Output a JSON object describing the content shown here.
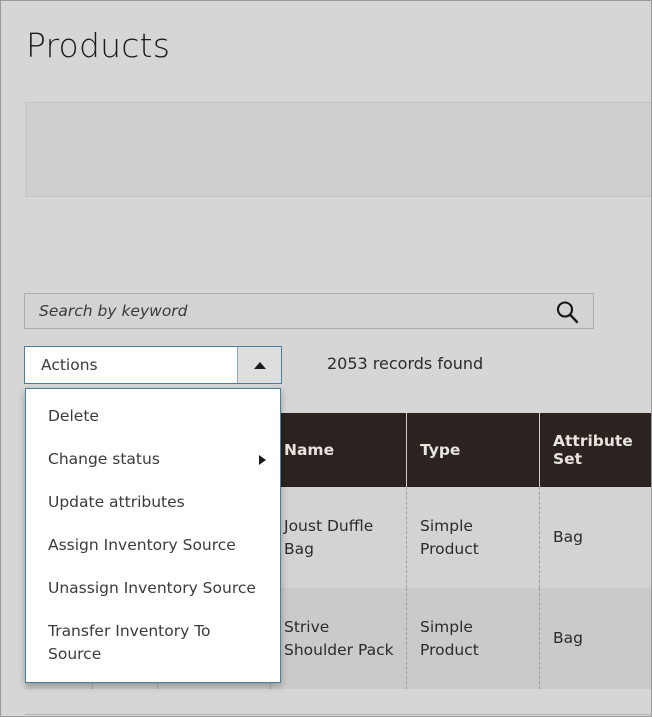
{
  "page": {
    "title": "Products",
    "background_color": "#d6d6d6"
  },
  "search": {
    "placeholder": "Search by keyword",
    "value": "",
    "icon": "search-icon"
  },
  "actions": {
    "label": "Actions",
    "caret_icon": "caret-up-icon",
    "expanded": true,
    "focus_border_color": "#4a7ea0",
    "menu_items": [
      {
        "label": "Delete",
        "has_submenu": false
      },
      {
        "label": "Change status",
        "has_submenu": true
      },
      {
        "label": "Update attributes",
        "has_submenu": false
      },
      {
        "label": "Assign Inventory Source",
        "has_submenu": false
      },
      {
        "label": "Unassign Inventory Source",
        "has_submenu": false
      },
      {
        "label": "Transfer Inventory To Source",
        "has_submenu": false
      }
    ]
  },
  "grid": {
    "records_found": "2053 records found",
    "header_background": "#2b2320",
    "columns": [
      {
        "label": "",
        "width_class": "c-0"
      },
      {
        "label": "",
        "width_class": "c-1"
      },
      {
        "label": "",
        "width_class": "c-2"
      },
      {
        "label": "Name",
        "width_class": "c-3"
      },
      {
        "label": "Type",
        "width_class": "c-4"
      },
      {
        "label": "Attribute Set",
        "width_class": "c-5"
      }
    ],
    "rows": [
      {
        "cells": [
          "",
          "",
          "",
          "Joust Duffle Bag",
          "Simple Product",
          "Bag"
        ]
      },
      {
        "cells": [
          "",
          "",
          "",
          "Strive Shoulder Pack",
          "Simple Product",
          "Bag"
        ]
      }
    ]
  }
}
